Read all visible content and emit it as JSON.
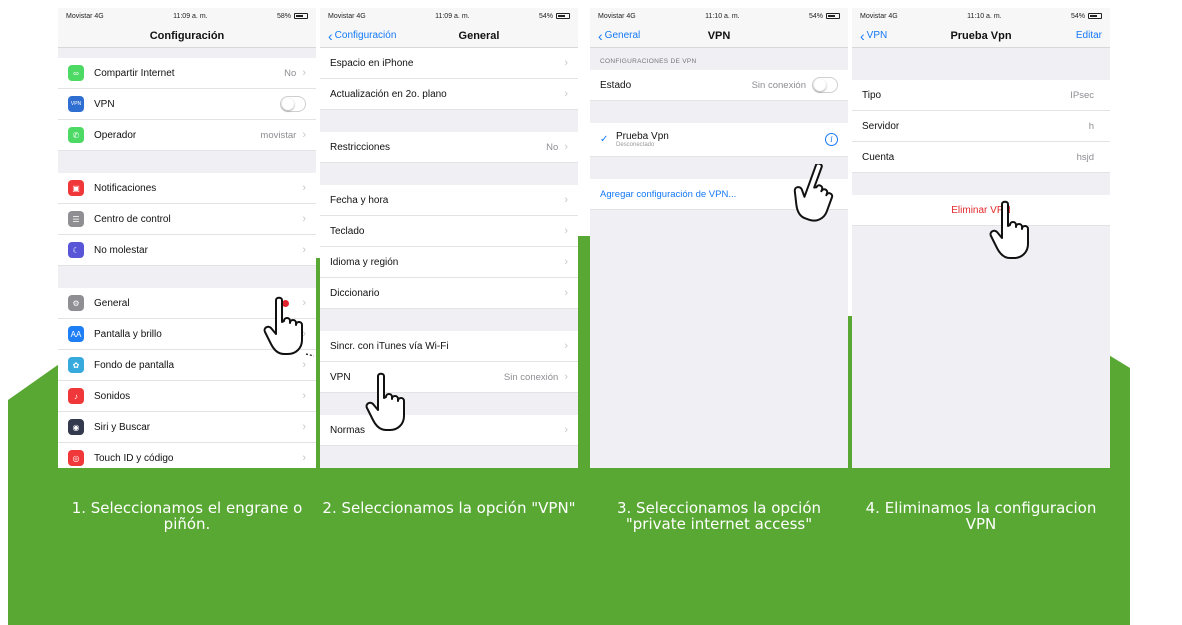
{
  "colors": {
    "green": "#58a833",
    "ios_blue": "#1479f6",
    "ios_red": "#e2292b",
    "grouped_bg": "#efeff4"
  },
  "screens": [
    {
      "status": {
        "carrier": "Movistar 4G",
        "time": "11:09 a. m.",
        "battery": "58%"
      },
      "nav": {
        "title": "Configuración"
      },
      "groups": [
        [
          {
            "label": "Compartir Internet",
            "value": "No",
            "icon": "hotspot-icon",
            "icon_color": "#4cd964"
          },
          {
            "label": "VPN",
            "value": "",
            "icon": "vpn-icon",
            "icon_color": "#2f6fd1",
            "toggle": true
          },
          {
            "label": "Operador",
            "value": "movistar",
            "icon": "phone-icon",
            "icon_color": "#4cd964"
          }
        ],
        [
          {
            "label": "Notificaciones",
            "value": "",
            "icon": "notifications-icon",
            "icon_color": "#f0383a"
          },
          {
            "label": "Centro de control",
            "value": "",
            "icon": "control-center-icon",
            "icon_color": "#8e8e93"
          },
          {
            "label": "No molestar",
            "value": "",
            "icon": "moon-icon",
            "icon_color": "#5856d6"
          }
        ],
        [
          {
            "label": "General",
            "value": "",
            "icon": "gear-icon",
            "icon_color": "#8e8e93"
          },
          {
            "label": "Pantalla y brillo",
            "value": "",
            "icon": "display-icon",
            "icon_color": "#1e7ef6"
          },
          {
            "label": "Fondo de pantalla",
            "value": "",
            "icon": "wallpaper-icon",
            "icon_color": "#36aadc"
          },
          {
            "label": "Sonidos",
            "value": "",
            "icon": "sound-icon",
            "icon_color": "#f0383a"
          },
          {
            "label": "Siri y Buscar",
            "value": "",
            "icon": "siri-icon",
            "icon_color": "#333a4d"
          },
          {
            "label": "Touch ID y código",
            "value": "",
            "icon": "fingerprint-icon",
            "icon_color": "#f0383a"
          }
        ]
      ],
      "caption": "1. Seleccionamos el engrane o piñón."
    },
    {
      "status": {
        "carrier": "Movistar 4G",
        "time": "11:09 a. m.",
        "battery": "54%"
      },
      "nav": {
        "back": "Configuración",
        "title": "General"
      },
      "rows": [
        {
          "label": "Espacio en iPhone",
          "value": ""
        },
        {
          "label": "Actualización en 2o. plano",
          "value": ""
        },
        {
          "label": "Restricciones",
          "value": "No"
        },
        {
          "label": "Fecha y hora",
          "value": ""
        },
        {
          "label": "Teclado",
          "value": ""
        },
        {
          "label": "Idioma y región",
          "value": ""
        },
        {
          "label": "Diccionario",
          "value": ""
        },
        {
          "label": "Sincr. con iTunes vía Wi-Fi",
          "value": ""
        },
        {
          "label": "VPN",
          "value": "Sin conexión"
        },
        {
          "label": "Normas",
          "value": ""
        }
      ],
      "caption": "2. Seleccionamos la opción \"VPN\""
    },
    {
      "status": {
        "carrier": "Movistar 4G",
        "time": "11:10 a. m.",
        "battery": "54%"
      },
      "nav": {
        "back": "General",
        "title": "VPN"
      },
      "section_header": "CONFIGURACIONES DE VPN",
      "estado": {
        "label": "Estado",
        "value": "Sin conexión"
      },
      "vpn_item": {
        "name": "Prueba Vpn",
        "sub": "Desconectado"
      },
      "add_link": "Agregar configuración de VPN...",
      "caption": "3. Seleccionamos la opción \"private internet access\""
    },
    {
      "status": {
        "carrier": "Movistar 4G",
        "time": "11:10 a. m.",
        "battery": "54%"
      },
      "nav": {
        "back": "VPN",
        "title": "Prueba Vpn",
        "right": "Editar"
      },
      "rows": [
        {
          "label": "Tipo",
          "value": "IPsec"
        },
        {
          "label": "Servidor",
          "value": "h"
        },
        {
          "label": "Cuenta",
          "value": "hsjd"
        }
      ],
      "delete_label": "Eliminar VPN",
      "caption": "4. Eliminamos la configuracion VPN"
    }
  ]
}
